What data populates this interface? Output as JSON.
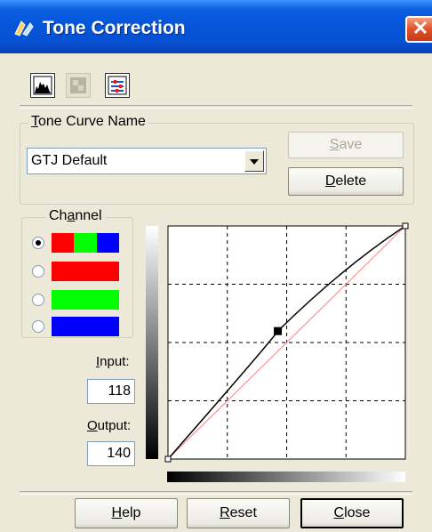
{
  "window": {
    "title": "Tone Correction",
    "close_symbol": "✕",
    "titlebar_colors": {
      "top": "#3d95ff",
      "bottom": "#0a3fb4"
    }
  },
  "toolbar": {
    "icons": [
      "histogram-icon",
      "image-adjustment-icon",
      "tone-adjust-icon"
    ]
  },
  "tone_curve": {
    "group_label": "Tone Curve Name",
    "selected_name": "GTJ Default",
    "save_label": "Save",
    "delete_label": "Delete"
  },
  "channel": {
    "group_label": "Channel",
    "options": [
      {
        "name": "RGB",
        "colors": [
          "#ff0000",
          "#00ff00",
          "#0000ff"
        ],
        "selected": true
      },
      {
        "name": "Red",
        "colors": [
          "#ff0000"
        ],
        "selected": false
      },
      {
        "name": "Green",
        "colors": [
          "#00ff00"
        ],
        "selected": false
      },
      {
        "name": "Blue",
        "colors": [
          "#0000ff"
        ],
        "selected": false
      }
    ]
  },
  "values": {
    "input_label": "Input:",
    "input_value": "118",
    "output_label": "Output:",
    "output_value": "140"
  },
  "curve": {
    "points": [
      [
        0,
        0
      ],
      [
        118,
        140
      ],
      [
        255,
        255
      ]
    ],
    "range": [
      0,
      255
    ],
    "curve_color": "#000000",
    "reference_color": "#ff9090"
  },
  "footer": {
    "help_label": "Help",
    "reset_label": "Reset",
    "close_label": "Close"
  }
}
